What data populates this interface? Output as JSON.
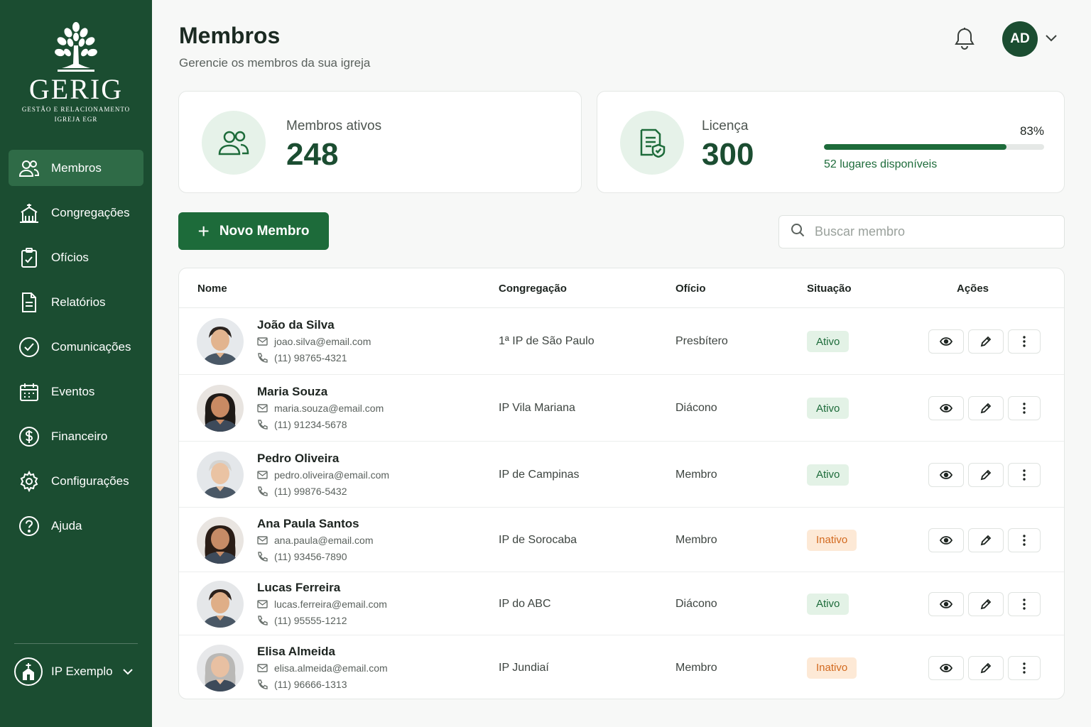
{
  "brand": {
    "name": "GERIG",
    "sub1": "GESTÃO E RELACIONAMENTO",
    "sub2": "IGREJA EGR"
  },
  "sidebar": {
    "items": [
      {
        "label": "Membros",
        "icon": "users-icon",
        "active": true
      },
      {
        "label": "Congregações",
        "icon": "church-building-icon"
      },
      {
        "label": "Ofícios",
        "icon": "clipboard-icon"
      },
      {
        "label": "Relatórios",
        "icon": "document-icon"
      },
      {
        "label": "Comunicações",
        "icon": "check-circle-icon"
      },
      {
        "label": "Eventos",
        "icon": "calendar-icon"
      },
      {
        "label": "Financeiro",
        "icon": "dollar-circle-icon"
      },
      {
        "label": "Configurações",
        "icon": "gear-icon"
      },
      {
        "label": "Ajuda",
        "icon": "help-circle-icon"
      }
    ],
    "church": {
      "label": "IP Exemplo",
      "icon": "church-icon"
    }
  },
  "header": {
    "title": "Membros",
    "subtitle": "Gerencie os membros da sua igreja",
    "user_initials": "AD"
  },
  "stats": {
    "members": {
      "label": "Membros ativos",
      "value": "248"
    },
    "license": {
      "label": "Licença",
      "value": "300",
      "percent_text": "83%",
      "percent": 0.83,
      "available": "52 lugares disponíveis"
    }
  },
  "actions": {
    "new_member": "Novo Membro",
    "search_placeholder": "Buscar membro"
  },
  "table": {
    "columns": {
      "name": "Nome",
      "congregation": "Congregação",
      "office": "Ofício",
      "status": "Situação",
      "actions": "Ações"
    },
    "rows": [
      {
        "name": "João da Silva",
        "email": "joao.silva@email.com",
        "phone": "(11) 98765-4321",
        "congregation": "1ª IP de São Paulo",
        "office": "Presbítero",
        "status": "Ativo"
      },
      {
        "name": "Maria Souza",
        "email": "maria.souza@email.com",
        "phone": "(11) 91234-5678",
        "congregation": "IP Vila Mariana",
        "office": "Diácono",
        "status": "Ativo"
      },
      {
        "name": "Pedro Oliveira",
        "email": "pedro.oliveira@email.com",
        "phone": "(11) 99876-5432",
        "congregation": "IP de Campinas",
        "office": "Membro",
        "status": "Ativo"
      },
      {
        "name": "Ana Paula Santos",
        "email": "ana.paula@email.com",
        "phone": "(11) 93456-7890",
        "congregation": "IP de Sorocaba",
        "office": "Membro",
        "status": "Inativo"
      },
      {
        "name": "Lucas Ferreira",
        "email": "lucas.ferreira@email.com",
        "phone": "(11) 95555-1212",
        "congregation": "IP do ABC",
        "office": "Diácono",
        "status": "Ativo"
      },
      {
        "name": "Elisa Almeida",
        "email": "elisa.almeida@email.com",
        "phone": "(11) 96666-1313",
        "congregation": "IP Jundiaí",
        "office": "Membro",
        "status": "Inativo"
      }
    ]
  },
  "colors": {
    "sidebar": "#1b4d31",
    "accent": "#1d6b3a",
    "active_badge": "#e3f2e6",
    "inactive_badge": "#fde9d6"
  }
}
